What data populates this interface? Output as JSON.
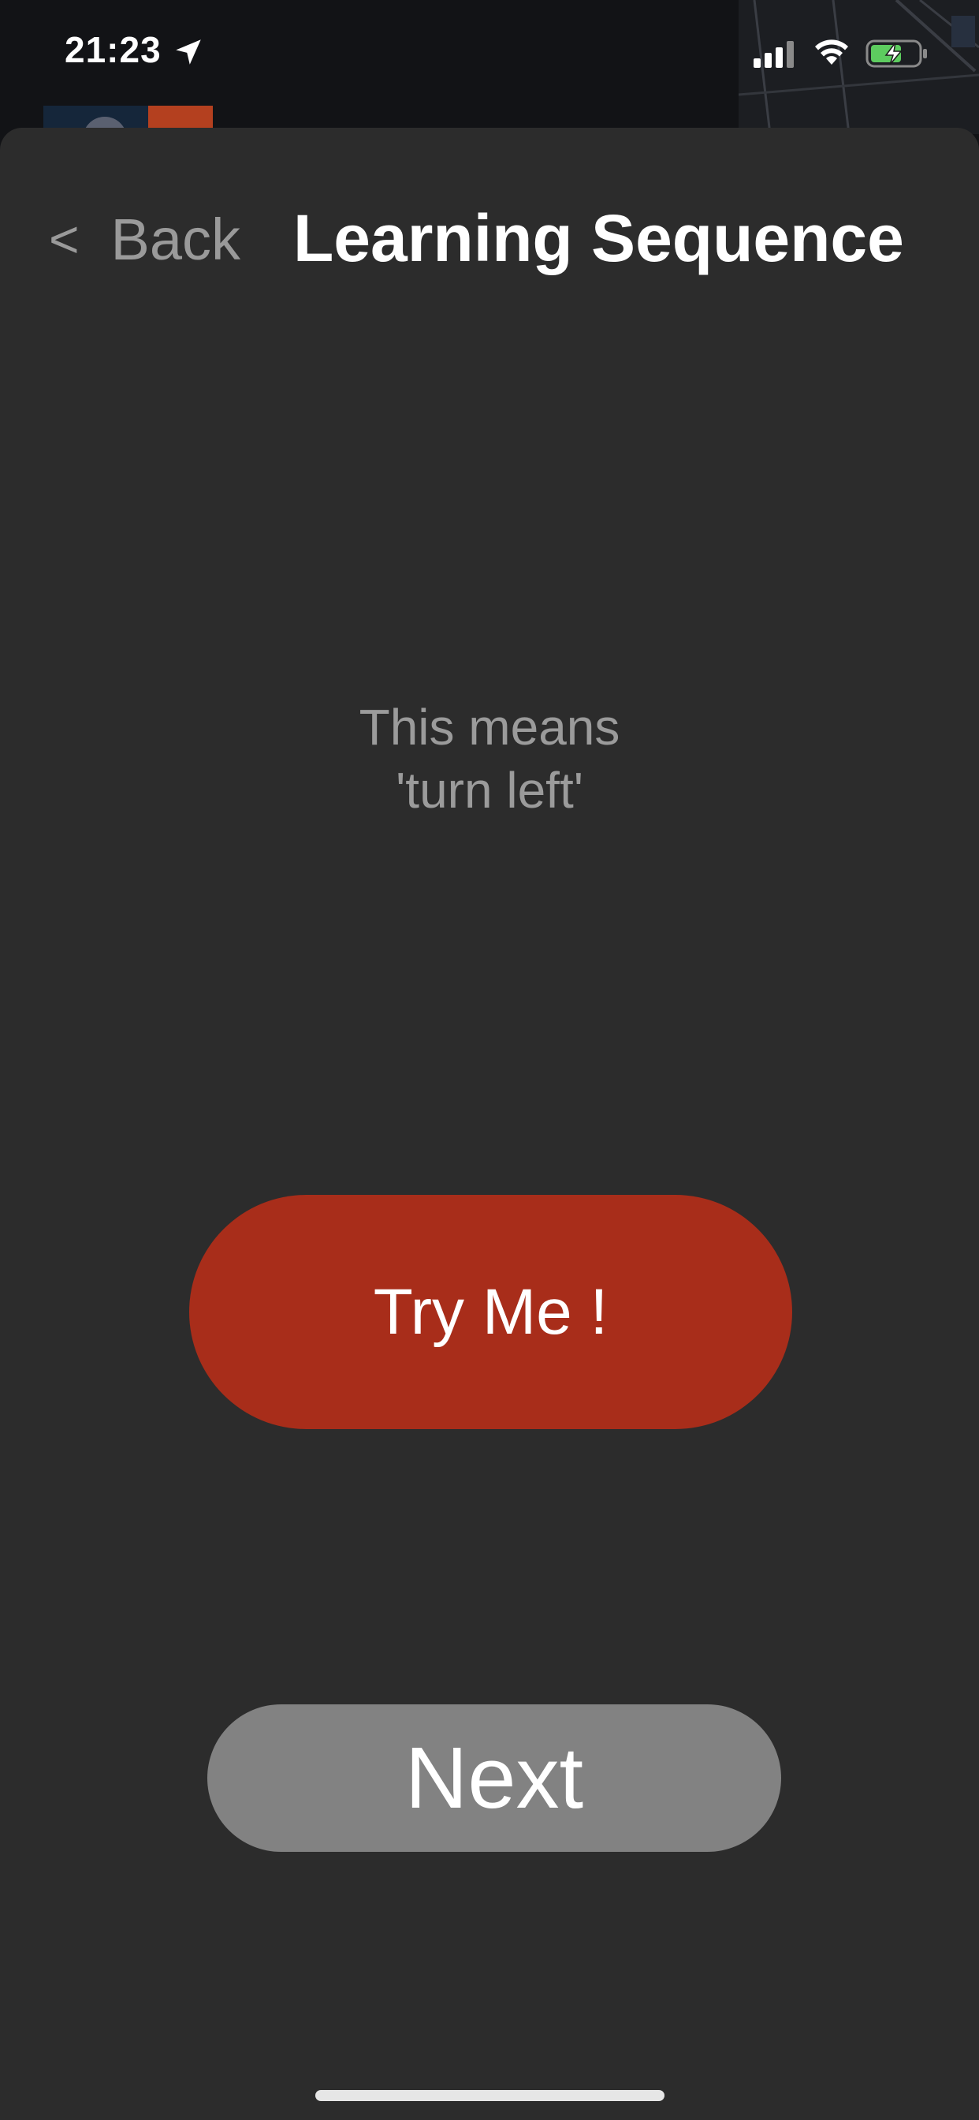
{
  "status_bar": {
    "time": "21:23",
    "icons": [
      "location-arrow-icon",
      "cellular-signal-icon",
      "wifi-icon",
      "battery-charging-icon"
    ]
  },
  "header": {
    "back_chevron": "<",
    "back_label": "Back",
    "title": "Learning Sequence"
  },
  "main": {
    "hint_line1": "This means",
    "hint_line2": "'turn left'",
    "try_button_label": "Try Me !",
    "next_button_label": "Next"
  },
  "colors": {
    "sheet_background": "#2c2c2c",
    "try_button": "#a82d1a",
    "next_button": "#828282",
    "battery_fill": "#5dcc5f",
    "hint_text": "#9b9b9b"
  }
}
